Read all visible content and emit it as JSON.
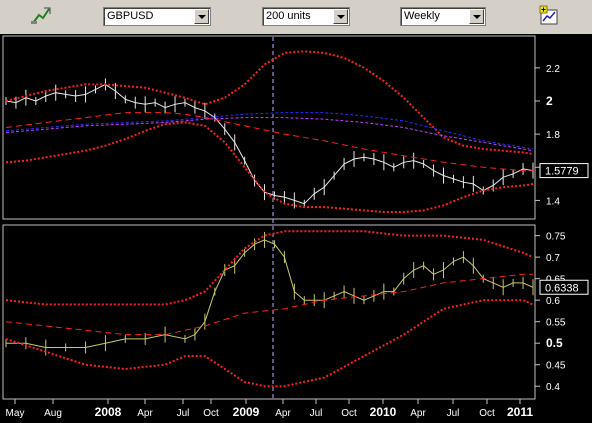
{
  "toolbar": {
    "draw_tool_icon": "pencil-chart-icon",
    "symbol": "GBPUSD",
    "units": "200 units",
    "period": "Weekly",
    "add_chart_icon": "add-chart-icon"
  },
  "chart_data": [
    {
      "type": "line",
      "panel": "price",
      "symbol": "GBPUSD",
      "yticks": [
        "2.2",
        "2",
        "1.8",
        "1.6",
        "1.4"
      ],
      "ylim": [
        1.3,
        2.38
      ],
      "last_value": "1.5779",
      "series": [
        {
          "values_desc": "weekly candles",
          "x": [
            0,
            10,
            20,
            30,
            40,
            50,
            60,
            70,
            80,
            90,
            100,
            110,
            120,
            130,
            140,
            150,
            160,
            170,
            180,
            190,
            200,
            210,
            220,
            230,
            240,
            250,
            260,
            270,
            280,
            290,
            300,
            310,
            320,
            330,
            340,
            350,
            360,
            370,
            380,
            390,
            400,
            410,
            420,
            430,
            440,
            450,
            460,
            470,
            480,
            490,
            500,
            510,
            520,
            530
          ],
          "values": [
            2.0,
            1.99,
            2.02,
            2.0,
            2.03,
            2.05,
            2.04,
            2.03,
            2.04,
            2.07,
            2.1,
            2.06,
            2.01,
            1.99,
            1.98,
            1.99,
            1.96,
            1.98,
            1.99,
            1.96,
            1.94,
            1.9,
            1.83,
            1.75,
            1.64,
            1.52,
            1.45,
            1.43,
            1.42,
            1.4,
            1.38,
            1.44,
            1.48,
            1.55,
            1.62,
            1.65,
            1.66,
            1.65,
            1.63,
            1.6,
            1.63,
            1.64,
            1.62,
            1.58,
            1.55,
            1.53,
            1.51,
            1.5,
            1.46,
            1.49,
            1.54,
            1.56,
            1.59,
            1.58
          ]
        },
        {
          "values_desc": "upper band",
          "x": [
            0,
            20,
            40,
            60,
            80,
            100,
            120,
            140,
            160,
            180,
            200,
            220,
            240,
            260,
            280,
            300,
            320,
            340,
            360,
            380,
            400,
            420,
            440,
            460,
            480,
            500,
            520,
            530
          ],
          "values": [
            2.0,
            2.03,
            2.06,
            2.08,
            2.1,
            2.1,
            2.09,
            2.08,
            2.05,
            2.02,
            1.98,
            2.02,
            2.1,
            2.22,
            2.29,
            2.3,
            2.29,
            2.26,
            2.2,
            2.12,
            2.02,
            1.9,
            1.78,
            1.73,
            1.71,
            1.7,
            1.69,
            1.68
          ]
        },
        {
          "values_desc": "lower band",
          "x": [
            0,
            20,
            40,
            60,
            80,
            100,
            120,
            140,
            160,
            180,
            200,
            220,
            240,
            260,
            280,
            300,
            320,
            340,
            360,
            380,
            400,
            420,
            440,
            460,
            480,
            500,
            520,
            530
          ],
          "values": [
            1.63,
            1.64,
            1.66,
            1.68,
            1.7,
            1.73,
            1.77,
            1.82,
            1.86,
            1.87,
            1.85,
            1.75,
            1.6,
            1.45,
            1.38,
            1.36,
            1.36,
            1.35,
            1.34,
            1.33,
            1.33,
            1.34,
            1.37,
            1.42,
            1.46,
            1.48,
            1.49,
            1.5
          ]
        },
        {
          "values_desc": "mid line",
          "x": [
            0,
            40,
            80,
            120,
            160,
            180,
            200,
            240,
            280,
            320,
            360,
            400,
            440,
            480,
            520,
            530
          ],
          "values": [
            1.84,
            1.87,
            1.9,
            1.93,
            1.93,
            1.92,
            1.9,
            1.85,
            1.8,
            1.76,
            1.71,
            1.67,
            1.63,
            1.6,
            1.58,
            1.58
          ]
        },
        {
          "values_desc": "blue average",
          "x": [
            0,
            40,
            80,
            120,
            160,
            200,
            240,
            280,
            320,
            360,
            400,
            440,
            480,
            520,
            530
          ],
          "values": [
            1.82,
            1.84,
            1.86,
            1.87,
            1.88,
            1.9,
            1.92,
            1.93,
            1.93,
            1.91,
            1.88,
            1.82,
            1.76,
            1.72,
            1.71
          ]
        },
        {
          "values_desc": "purple average",
          "x": [
            0,
            40,
            80,
            120,
            160,
            200,
            240,
            280,
            320,
            360,
            400,
            440,
            480,
            520,
            530
          ],
          "values": [
            1.81,
            1.83,
            1.85,
            1.86,
            1.87,
            1.89,
            1.9,
            1.9,
            1.89,
            1.87,
            1.84,
            1.79,
            1.75,
            1.71,
            1.7
          ]
        }
      ]
    },
    {
      "type": "line",
      "panel": "indicator",
      "yticks": [
        "0.75",
        "0.7",
        "0.65",
        "0.6",
        "0.55",
        "0.5",
        "0.45",
        "0.4"
      ],
      "ylim": [
        0.375,
        0.77
      ],
      "last_value": "0.6338",
      "series": [
        {
          "values_desc": "indicator",
          "x": [
            0,
            20,
            40,
            60,
            80,
            100,
            120,
            140,
            160,
            180,
            190,
            200,
            210,
            220,
            230,
            240,
            250,
            260,
            270,
            280,
            290,
            300,
            310,
            320,
            330,
            340,
            350,
            360,
            370,
            380,
            390,
            400,
            410,
            420,
            430,
            440,
            450,
            460,
            470,
            480,
            490,
            500,
            510,
            520,
            530
          ],
          "values": [
            0.5,
            0.5,
            0.49,
            0.49,
            0.49,
            0.5,
            0.51,
            0.51,
            0.52,
            0.51,
            0.52,
            0.55,
            0.62,
            0.67,
            0.68,
            0.71,
            0.73,
            0.74,
            0.73,
            0.7,
            0.62,
            0.6,
            0.6,
            0.6,
            0.61,
            0.62,
            0.61,
            0.6,
            0.61,
            0.62,
            0.62,
            0.65,
            0.67,
            0.68,
            0.66,
            0.67,
            0.69,
            0.7,
            0.68,
            0.65,
            0.64,
            0.63,
            0.64,
            0.64,
            0.63
          ]
        },
        {
          "values_desc": "upper band",
          "x": [
            0,
            40,
            80,
            120,
            160,
            180,
            200,
            220,
            240,
            260,
            280,
            300,
            320,
            360,
            400,
            440,
            480,
            520,
            530
          ],
          "values": [
            0.6,
            0.59,
            0.59,
            0.59,
            0.59,
            0.6,
            0.62,
            0.67,
            0.72,
            0.75,
            0.76,
            0.76,
            0.76,
            0.76,
            0.75,
            0.75,
            0.74,
            0.71,
            0.7
          ]
        },
        {
          "values_desc": "lower band",
          "x": [
            0,
            40,
            80,
            120,
            160,
            180,
            200,
            220,
            240,
            260,
            280,
            300,
            320,
            360,
            400,
            440,
            480,
            520,
            530
          ],
          "values": [
            0.51,
            0.48,
            0.45,
            0.44,
            0.45,
            0.47,
            0.47,
            0.44,
            0.41,
            0.4,
            0.4,
            0.41,
            0.42,
            0.47,
            0.52,
            0.58,
            0.6,
            0.6,
            0.59
          ]
        },
        {
          "values_desc": "mid line",
          "x": [
            0,
            40,
            80,
            120,
            160,
            180,
            200,
            240,
            280,
            320,
            360,
            400,
            440,
            480,
            520,
            530
          ],
          "values": [
            0.55,
            0.54,
            0.53,
            0.52,
            0.52,
            0.53,
            0.54,
            0.57,
            0.58,
            0.6,
            0.61,
            0.62,
            0.64,
            0.65,
            0.66,
            0.66
          ]
        }
      ]
    }
  ],
  "x_axis": {
    "labels": [
      "May",
      "Aug",
      "2008",
      "Apr",
      "Jul",
      "Oct",
      "2009",
      "Apr",
      "Jul",
      "Oct",
      "2010",
      "Apr",
      "Jul",
      "Oct",
      "2011"
    ],
    "bold": [
      false,
      false,
      true,
      false,
      false,
      false,
      true,
      false,
      false,
      false,
      true,
      false,
      false,
      false,
      true
    ]
  },
  "colors": {
    "background": "#000000",
    "candles": "#e8e8e8",
    "indicator": "#c8c86a",
    "bands": "#ff2020",
    "mid": "#ff2020",
    "blue": "#2a2aff",
    "purple": "#c040ff",
    "axis_text": "#ffffff",
    "last_box": "#000000"
  }
}
